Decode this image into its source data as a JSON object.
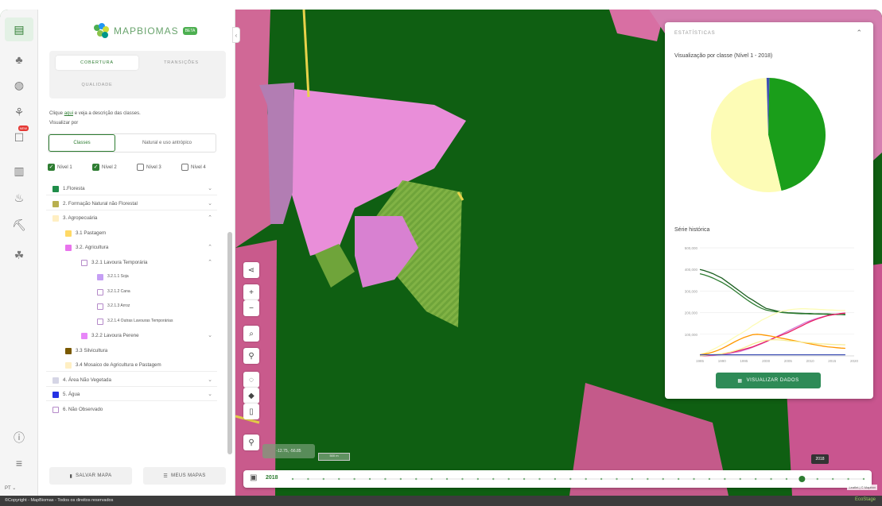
{
  "app": {
    "name": "MAPBIOMAS",
    "badge": "BETA"
  },
  "tabs": {
    "cobertura": "COBERTURA",
    "transicoes": "TRANSIÇÕES",
    "qualidade": "QUALIDADE"
  },
  "legend_panel": {
    "info_pre": "Clique",
    "info_link": "aqui",
    "info_post": "e veja a descrição das classes.",
    "view_label": "Visualizar por",
    "view_options": [
      "Classes",
      "Natural e uso antrópico"
    ],
    "levels": [
      {
        "label": "Nível 1",
        "checked": true
      },
      {
        "label": "Nível 2",
        "checked": true
      },
      {
        "label": "Nível 3",
        "checked": false
      },
      {
        "label": "Nível 4",
        "checked": false
      }
    ],
    "classes": [
      {
        "label": "1.Floresta",
        "color": "#1f8d49",
        "indent": 0,
        "chevron": "v"
      },
      {
        "label": "2. Formação Natural não Florestal",
        "color": "#b8af4f",
        "indent": 0,
        "chevron": "v"
      },
      {
        "label": "3. Agropecuária",
        "color": "#ffefc3",
        "indent": 0,
        "chevron": "^"
      },
      {
        "label": "3.1 Pastagem",
        "color": "#ffd966",
        "indent": 1,
        "chevron": ""
      },
      {
        "label": "3.2. Agricultura",
        "color": "#e974ed",
        "indent": 1,
        "chevron": "^"
      },
      {
        "label": "3.2.1 Lavoura Temporária",
        "color": "#ffffff",
        "indent": 2,
        "chevron": "^"
      },
      {
        "label": "3.2.1.1 Soja",
        "color": "#c59ff4",
        "indent": 3,
        "chevron": ""
      },
      {
        "label": "3.2.1.2 Cana",
        "color": "#ffffff",
        "indent": 3,
        "chevron": ""
      },
      {
        "label": "3.2.1.3 Arroz",
        "color": "#ffffff",
        "indent": 3,
        "chevron": ""
      },
      {
        "label": "3.2.1.4 Outras Lavouras Temporárias",
        "color": "#ffffff",
        "indent": 3,
        "chevron": ""
      },
      {
        "label": "3.2.2 Lavoura Perene",
        "color": "#e787f8",
        "indent": 2,
        "chevron": "v"
      },
      {
        "label": "3.3 Silvicultura",
        "color": "#7a5900",
        "indent": 1,
        "chevron": ""
      },
      {
        "label": "3.4 Mosaico de Agricultura e Pastagem",
        "color": "#ffefc3",
        "indent": 1,
        "chevron": ""
      },
      {
        "label": "4. Área Não Vegetada",
        "color": "#d5d5e5",
        "indent": 0,
        "chevron": "v"
      },
      {
        "label": "5. Água",
        "color": "#2532e4",
        "indent": 0,
        "chevron": "v"
      },
      {
        "label": "6. Não Observado",
        "color": "#ffffff",
        "indent": 0,
        "chevron": ""
      }
    ]
  },
  "actions": {
    "save": "SALVAR MAPA",
    "my_maps": "MEUS MAPAS"
  },
  "lang": "PT",
  "map": {
    "coords": "-12.75, -56.85",
    "scale": "500 m",
    "year": "2018",
    "year_tip": "2018",
    "attribution": "Leaflet | © Mapbox"
  },
  "stats": {
    "header": "ESTATÍSTICAS",
    "pie_title": "Visualização por classe (Nível 1 - 2018)",
    "series_title": "Série histórica",
    "button": "VISUALIZAR DADOS",
    "colors": {
      "forest": "#1a9e1a",
      "agro": "#fdfcb6",
      "water": "#3f51b5",
      "magenta": "#e91e63",
      "orange": "#ff9800",
      "pink": "#d47cd6",
      "yellow": "#f7ec94",
      "green2": "#4caf50"
    }
  },
  "chart_data": {
    "type": "line",
    "title": "",
    "ylim": [
      0,
      500000
    ],
    "ytick_labels": [
      "100,000",
      "200,000",
      "300,000",
      "400,000",
      "500,000"
    ],
    "x": [
      1985,
      1986,
      1987,
      1988,
      1989,
      1990,
      1991,
      1992,
      1993,
      1994,
      1995,
      1996,
      1997,
      1998,
      1999,
      2000,
      2001,
      2002,
      2003,
      2004,
      2005,
      2006,
      2007,
      2008,
      2009,
      2010,
      2011,
      2012,
      2013,
      2014,
      2015,
      2016,
      2017,
      2018
    ],
    "xtick_labels": [
      "1985",
      "1990",
      "1995",
      "2000",
      "2005",
      "2010",
      "2015",
      "2020"
    ],
    "series": [
      {
        "color": "#1b5e20",
        "values": [
          400000,
          395000,
          388000,
          380000,
          370000,
          360000,
          345000,
          330000,
          315000,
          300000,
          285000,
          270000,
          258000,
          245000,
          232000,
          220000,
          215000,
          210000,
          205000,
          202000,
          200000,
          199000,
          198000,
          197000,
          196000,
          196000,
          195000,
          195000,
          194000,
          194000,
          193000,
          193000,
          192000,
          192000
        ]
      },
      {
        "color": "#2e7d32",
        "values": [
          380000,
          375000,
          368000,
          360000,
          350000,
          340000,
          328000,
          315000,
          300000,
          285000,
          270000,
          255000,
          242000,
          230000,
          220000,
          212000,
          208000,
          205000,
          202000,
          200000,
          198000,
          197000,
          196000,
          195000,
          195000,
          194000,
          194000,
          193000,
          193000,
          192000,
          192000,
          191000,
          191000,
          190000
        ]
      },
      {
        "color": "#fdfcb6",
        "values": [
          5000,
          12000,
          20000,
          30000,
          40000,
          52000,
          62000,
          75000,
          88000,
          100000,
          112000,
          125000,
          140000,
          152000,
          165000,
          175000,
          185000,
          195000,
          203000,
          208000,
          212000,
          215000,
          217000,
          218000,
          218000,
          217000,
          216000,
          215000,
          214000,
          213000,
          212000,
          211000,
          210000,
          210000
        ]
      },
      {
        "color": "#d47cd6",
        "values": [
          0,
          0,
          1000,
          2000,
          4000,
          6000,
          9000,
          12000,
          16000,
          20000,
          26000,
          32000,
          40000,
          48000,
          56000,
          65000,
          75000,
          85000,
          95000,
          105000,
          115000,
          125000,
          135000,
          145000,
          155000,
          163000,
          170000,
          176000,
          182000,
          186000,
          190000,
          193000,
          196000,
          198000
        ]
      },
      {
        "color": "#e91e63",
        "values": [
          0,
          1000,
          2000,
          4000,
          6000,
          9000,
          12000,
          16000,
          20000,
          25000,
          30000,
          36000,
          42000,
          50000,
          58000,
          66000,
          75000,
          84000,
          92000,
          100000,
          108000,
          118000,
          128000,
          138000,
          148000,
          158000,
          166000,
          174000,
          180000,
          186000,
          190000,
          193000,
          196000,
          198000
        ]
      },
      {
        "color": "#ff9800",
        "values": [
          5000,
          8000,
          12000,
          18000,
          25000,
          34000,
          44000,
          55000,
          66000,
          76000,
          85000,
          92000,
          98000,
          100000,
          98000,
          95000,
          92000,
          88000,
          84000,
          80000,
          76000,
          72000,
          68000,
          64000,
          60000,
          56000,
          52000,
          48000,
          45000,
          42000,
          40000,
          38000,
          36000,
          35000
        ]
      },
      {
        "color": "#f7ec94",
        "values": [
          0,
          2000,
          4000,
          6000,
          8000,
          10000,
          14000,
          18000,
          24000,
          30000,
          38000,
          46000,
          55000,
          62000,
          68000,
          72000,
          74000,
          75000,
          74000,
          72000,
          70000,
          68000,
          66000,
          64000,
          62000,
          60000,
          58000,
          56000,
          55000,
          54000,
          53000,
          52000,
          52000,
          51000
        ]
      },
      {
        "color": "#3f51b5",
        "values": [
          5000,
          5000,
          5000,
          5000,
          5000,
          5000,
          5000,
          5000,
          5000,
          5000,
          5000,
          5000,
          5000,
          5000,
          5000,
          5000,
          5000,
          5000,
          5000,
          5000,
          5000,
          5000,
          5000,
          5000,
          5000,
          5000,
          5000,
          5000,
          5000,
          5000,
          5000,
          5000,
          5000,
          5000
        ]
      }
    ],
    "pie": {
      "title": "Visualização por classe (Nível 1 - 2018)",
      "slices": [
        {
          "label": "1.Floresta",
          "value": 46,
          "color": "#1a9e1a"
        },
        {
          "label": "3. Agropecuária",
          "value": 53.2,
          "color": "#fdfcb6"
        },
        {
          "label": "5. Água",
          "value": 0.8,
          "color": "#3f51b5"
        }
      ]
    }
  },
  "footer": {
    "text": "©Copyright - MapBiomas - Todos os direitos reservados",
    "brand": "EcoStage"
  }
}
